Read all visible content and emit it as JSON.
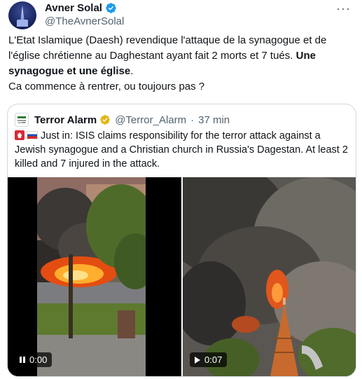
{
  "tweet": {
    "author_name": "Avner Solal",
    "author_handle": "@TheAvnerSolal",
    "more_label": "···",
    "text_part1": "L'Etat Islamique (Daesh) revendique l'attaque de la synagogue et de l'église chrétienne au Daghestant ayant fait 2 morts et 7 tués. ",
    "text_bold": "Une synagogue et une église",
    "text_part2": ".",
    "text_line2": "Ca commence à rentrer, ou toujours pas ?"
  },
  "quote": {
    "author_name": "Terror Alarm",
    "author_handle": "@Terror_Alarm",
    "separator": "·",
    "time": "37 min",
    "avatar_text": "TERROR ALARM",
    "text": "Just in: ISIS claims responsibility for the terror attack against a Jewish synagogue and a Christian church in Russia's Dagestan. At least 2 killed and 7 injured in the attack."
  },
  "videos": [
    {
      "state": "paused",
      "time": "0:00"
    },
    {
      "state": "play",
      "time": "0:07"
    }
  ],
  "colors": {
    "verified_blue": "#1d9bf0",
    "verified_gold": "#e2b719",
    "text": "#0f1419",
    "muted": "#536471"
  }
}
